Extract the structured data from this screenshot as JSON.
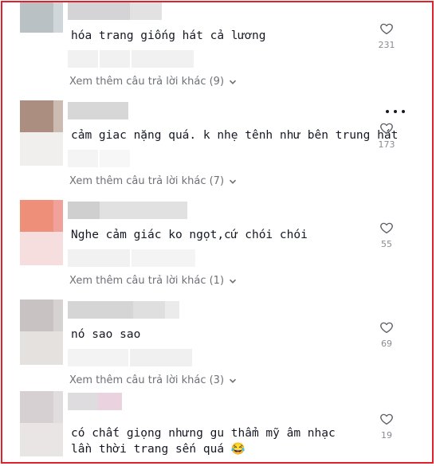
{
  "comments": [
    {
      "text": "hóa trang giống hát cả lương",
      "likes": "231"
    },
    {
      "text": "cảm giac nặng quá. k nhẹ tênh như bên trung hát",
      "likes": "173"
    },
    {
      "text": "Nghe cảm giác ko ngọt,cứ chói chói",
      "likes": "55"
    },
    {
      "text": "nó sao sao",
      "likes": "69"
    },
    {
      "text": "có chất giọng nhưng gu thẩm mỹ âm nhạc lần thời trang sến quá 😂",
      "likes": "19"
    }
  ],
  "view_more": [
    "Xem thêm câu trả lời khác (9)",
    "Xem thêm câu trả lời khác (7)",
    "Xem thêm câu trả lời khác (1)",
    "Xem thêm câu trả lời khác (3)"
  ],
  "colors": {
    "frame_border": "#e0202a",
    "text": "#161823",
    "muted": "#8a8b91"
  },
  "icons": {
    "like": "heart-outline-icon",
    "more": "ellipsis-icon",
    "expand": "chevron-down-icon"
  }
}
